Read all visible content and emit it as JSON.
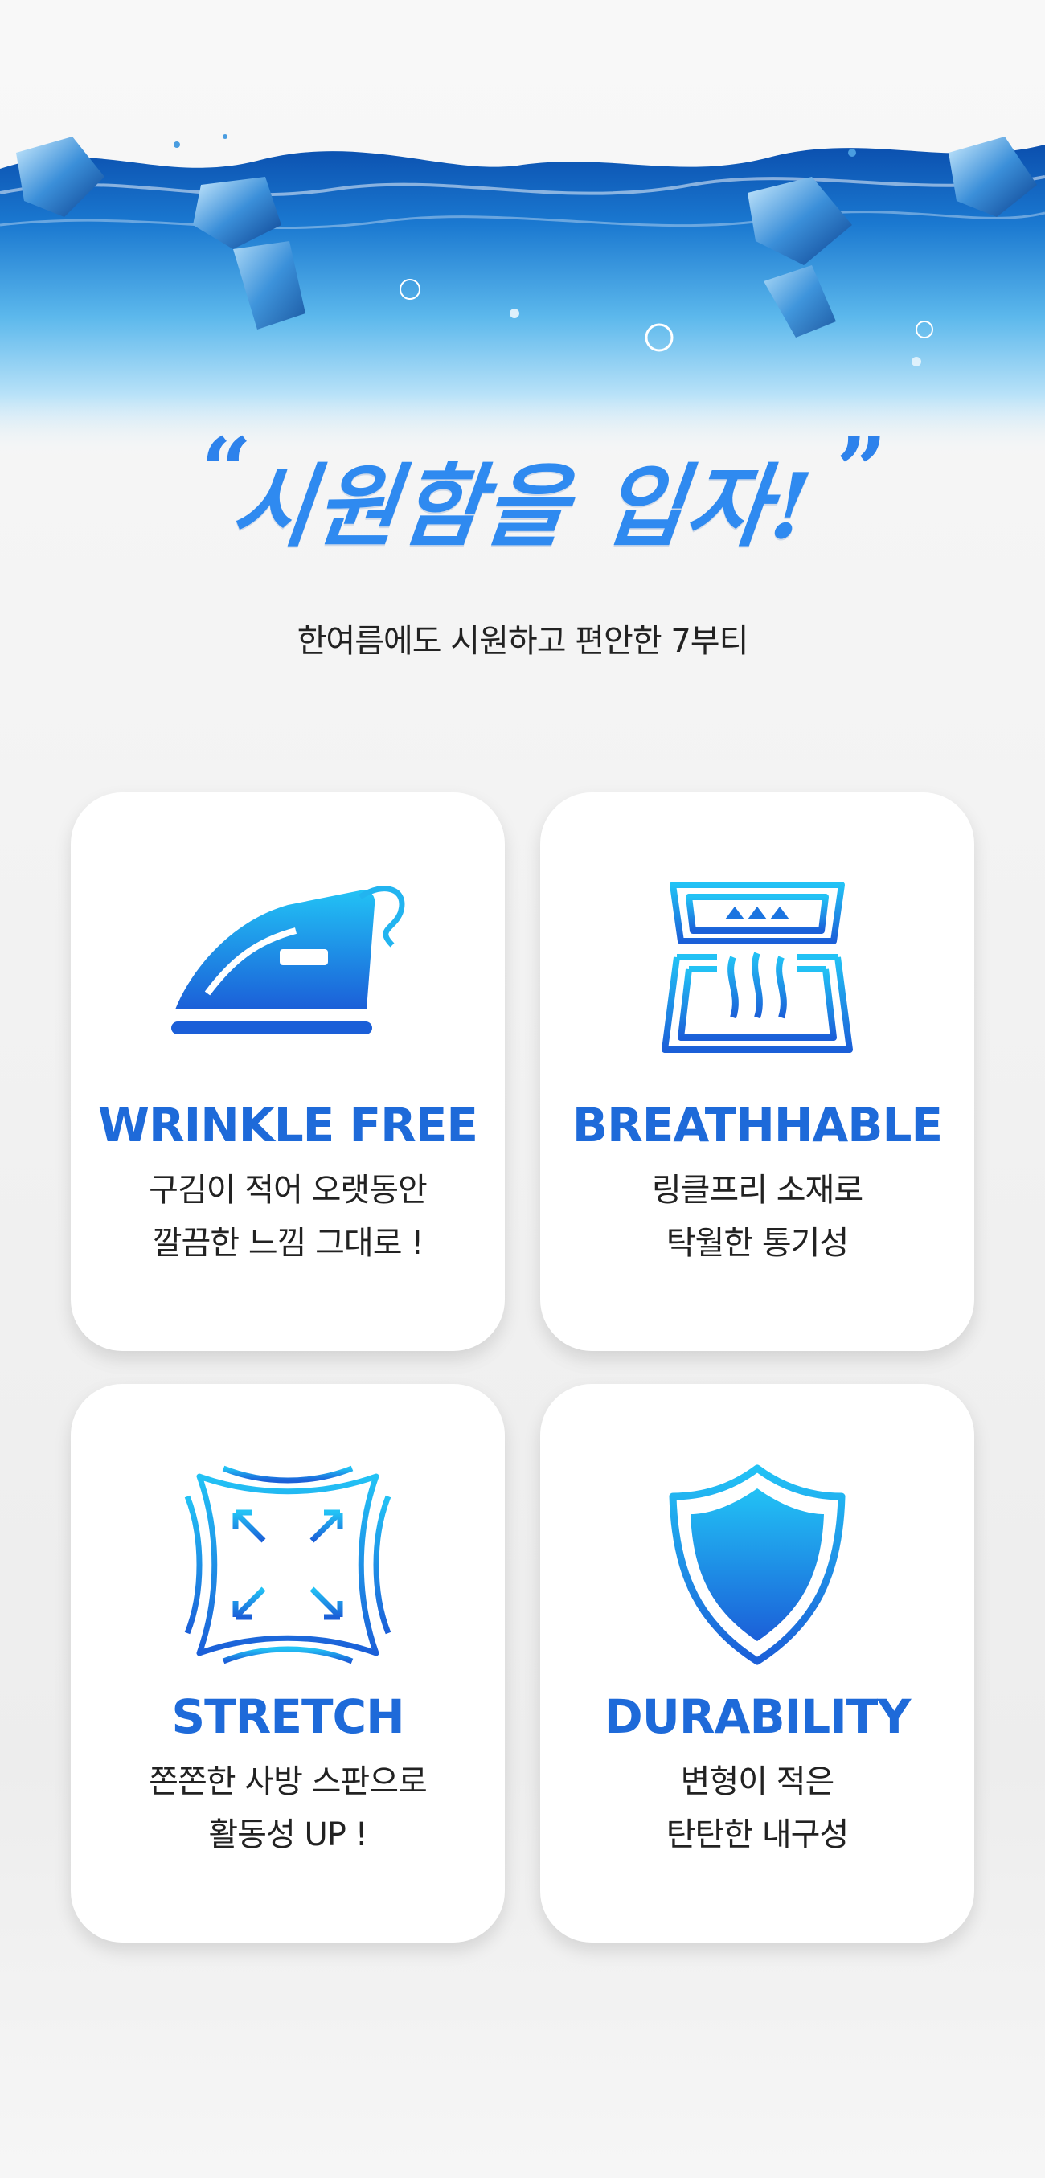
{
  "hero": {
    "quote_open": "“",
    "title": "시원함을 입자!",
    "quote_close": "”",
    "subtitle": "한여름에도 시원하고 편안한 7부티"
  },
  "features": [
    {
      "icon": "iron-icon",
      "title": "WRINKLE FREE",
      "line1": "구김이 적어 오랫동안",
      "line2": "깔끔한 느낌 그대로 !"
    },
    {
      "icon": "breathable-fabric-icon",
      "title": "BREATHHABLE",
      "line1": "링클프리 소재로",
      "line2": "탁월한 통기성"
    },
    {
      "icon": "stretch-fabric-icon",
      "title": "STRETCH",
      "line1": "쫀쫀한 사방 스판으로",
      "line2": "활동성 UP !"
    },
    {
      "icon": "shield-icon",
      "title": "DURABILITY",
      "line1": "변형이 적은",
      "line2": "탄탄한 내구성"
    }
  ],
  "colors": {
    "accent": "#1e6ad9",
    "light_blue": "#21b7f2"
  }
}
